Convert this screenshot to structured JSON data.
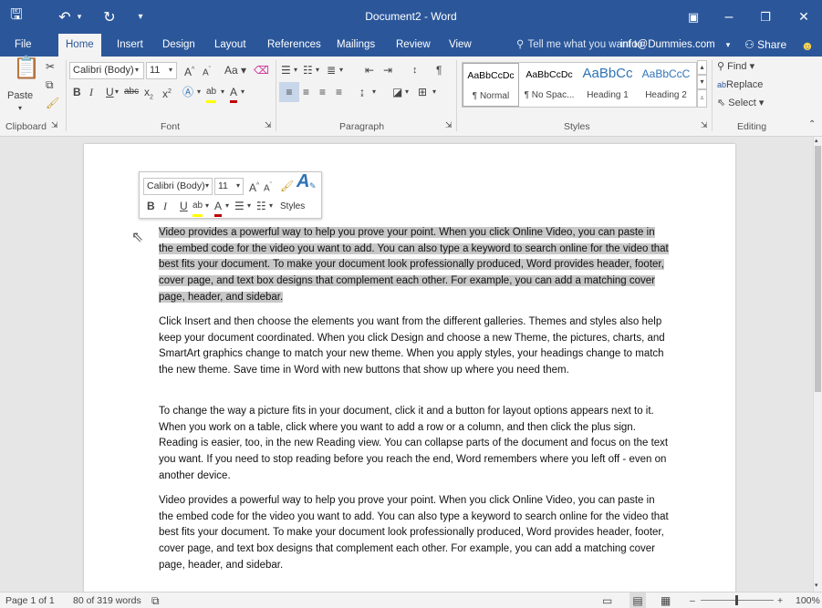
{
  "window": {
    "title": "Document2 - Word",
    "buttons": {
      "save": "🖫",
      "undo": "↶",
      "undo_arrow": "▾",
      "redo": "↻",
      "customize": "▾",
      "ribbon_options": "▣",
      "minimize": "–",
      "restore": "❐",
      "close": "✕"
    }
  },
  "tabs": [
    "File",
    "Home",
    "Insert",
    "Design",
    "Layout",
    "References",
    "Mailings",
    "Review",
    "View"
  ],
  "active_tab": "Home",
  "tell_me": "Tell me what you want to",
  "account": "info@Dummies.com",
  "share": "Share",
  "ribbon": {
    "clipboard": {
      "label": "Clipboard",
      "paste": "Paste"
    },
    "font": {
      "label": "Font",
      "font_name": "Calibri (Body)",
      "font_size": "11",
      "case": "Aa"
    },
    "paragraph": {
      "label": "Paragraph"
    },
    "styles": {
      "label": "Styles",
      "items": [
        {
          "sample": "AaBbCcDc",
          "name": "¶ Normal"
        },
        {
          "sample": "AaBbCcDc",
          "name": "¶ No Spac..."
        },
        {
          "sample": "AaBbCc",
          "name": "Heading 1"
        },
        {
          "sample": "AaBbCcC",
          "name": "Heading 2"
        }
      ]
    },
    "editing": {
      "label": "Editing",
      "find": "Find",
      "replace": "Replace",
      "select": "Select"
    }
  },
  "mini_toolbar": {
    "font_name": "Calibri (Body)",
    "font_size": "11",
    "styles": "Styles"
  },
  "document": {
    "paragraphs": [
      "Video provides a powerful way to help you prove your point. When you click Online Video, you can paste in the embed code for the video you want to add. You can also type a keyword to search online for the video that best fits your document. To make your document look professionally produced, Word provides header, footer, cover page, and text box designs that complement each other. For example, you can add a matching cover page, header, and sidebar.",
      "Click Insert and then choose the elements you want from the different galleries. Themes and styles also help keep your document coordinated. When you click Design and choose a new Theme, the pictures, charts, and SmartArt graphics change to match your new theme. When you apply styles, your headings change to match the new theme. Save time in Word with new buttons that show up where you need them.",
      "To change the way a picture fits in your document, click it and a button for layout options appears next to it. When you work on a table, click where you want to add a row or a column, and then click the plus sign. Reading is easier, too, in the new Reading view. You can collapse parts of the document and focus on the text you want. If you need to stop reading before you reach the end, Word remembers where you left off - even on another device.",
      "Video provides a powerful way to help you prove your point. When you click Online Video, you can paste in the embed code for the video you want to add. You can also type a keyword to search online for the video that best fits your document. To make your document look professionally produced, Word provides header, footer, cover page, and text box designs that complement each other. For example, you can add a matching cover page, header, and sidebar."
    ],
    "selected_paragraph_index": 0
  },
  "status": {
    "page": "Page 1 of 1",
    "words": "80 of 319 words",
    "zoom": "100%",
    "zoom_minus": "–",
    "zoom_plus": "+"
  },
  "colors": {
    "accent": "#2b579a",
    "selection": "#c8c8c8",
    "heading": "#2e74b5",
    "font_color": "#c00000",
    "highlight": "#ffff00"
  }
}
